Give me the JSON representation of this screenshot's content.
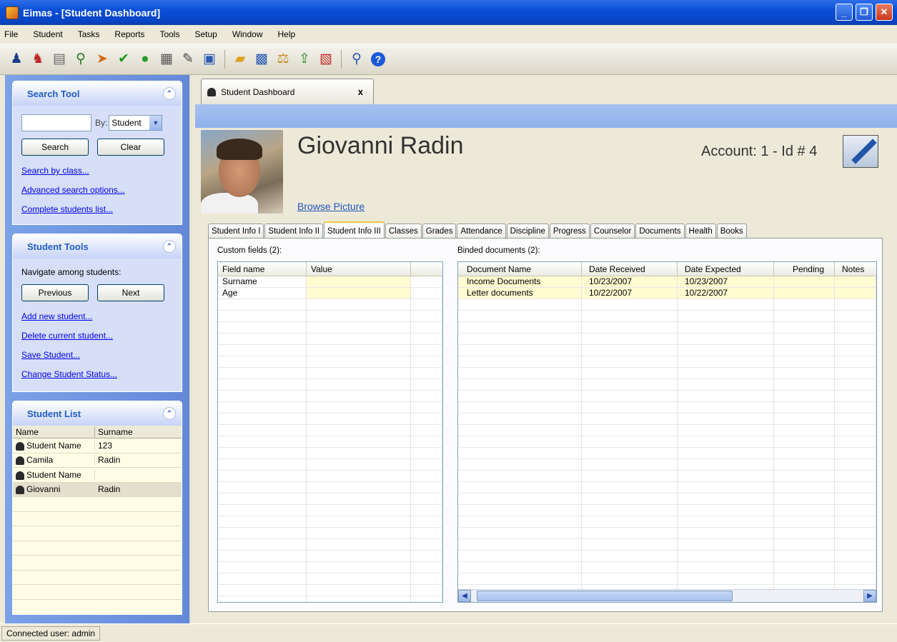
{
  "window": {
    "title": "Eimas - [Student Dashboard]"
  },
  "menu": [
    "File",
    "Student",
    "Tasks",
    "Reports",
    "Tools",
    "Setup",
    "Window",
    "Help"
  ],
  "toolbar": {
    "icons": [
      "student-icon",
      "students-icon",
      "document-icon",
      "key-icon",
      "arrow-icon",
      "checkmark-icon",
      "chat-icon",
      "form-icon",
      "pen-icon",
      "window-icon",
      "folder-icon",
      "monitor-icon",
      "scale-icon",
      "export-icon",
      "report-icon",
      "search-icon",
      "help-icon"
    ]
  },
  "search_tool": {
    "title": "Search Tool",
    "input_value": "",
    "by_label": "By:",
    "by_value": "Student",
    "search_btn": "Search",
    "clear_btn": "Clear",
    "links": [
      "Search by class...",
      "Advanced search options...",
      "Complete students list..."
    ]
  },
  "student_tools": {
    "title": "Student Tools",
    "navigate_label": "Navigate among students:",
    "previous_btn": "Previous",
    "next_btn": "Next",
    "links": [
      "Add new student...",
      "Delete current student...",
      "Save Student...",
      "Change Student Status..."
    ]
  },
  "student_list": {
    "title": "Student List",
    "columns": [
      "Name",
      "Surname"
    ],
    "rows": [
      {
        "name": "Student Name",
        "surname": "123"
      },
      {
        "name": "Camila",
        "surname": "Radin"
      },
      {
        "name": "Student Name",
        "surname": ""
      },
      {
        "name": "Giovanni",
        "surname": "Radin"
      }
    ]
  },
  "doc_tab": {
    "label": "Student Dashboard",
    "close": "x"
  },
  "student": {
    "name": "Giovanni Radin",
    "browse_picture": "Browse Picture",
    "account": "Account: 1 - Id # 4"
  },
  "tabs": [
    "Student Info I",
    "Student Info II",
    "Student Info III",
    "Classes",
    "Grades",
    "Attendance",
    "Discipline",
    "Progress",
    "Counselor",
    "Documents",
    "Health",
    "Books"
  ],
  "active_tab": "Student Info III",
  "custom_fields": {
    "label": "Custom fields (2):",
    "columns": [
      "Field name",
      "Value"
    ],
    "rows": [
      {
        "field": "Surname",
        "value": ""
      },
      {
        "field": "Age",
        "value": ""
      }
    ]
  },
  "binded_documents": {
    "label": "Binded documents (2):",
    "columns": [
      "Document Name",
      "Date Received",
      "Date Expected",
      "Pending",
      "Notes"
    ],
    "rows": [
      {
        "name": "Income Documents",
        "received": "10/23/2007",
        "expected": "10/23/2007",
        "pending": "",
        "notes": ""
      },
      {
        "name": "Letter documents",
        "received": "10/22/2007",
        "expected": "10/22/2007",
        "pending": "",
        "notes": ""
      }
    ]
  },
  "status": {
    "user": "Connected user: admin"
  }
}
